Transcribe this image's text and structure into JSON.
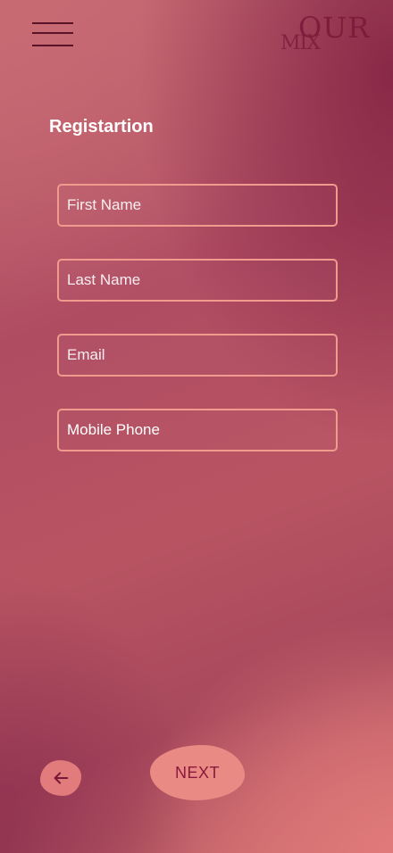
{
  "header": {
    "logo_line1": "OUR",
    "logo_line2": "MIX"
  },
  "form": {
    "title": "Registartion",
    "fields": [
      {
        "placeholder": "First Name"
      },
      {
        "placeholder": "Last Name"
      },
      {
        "placeholder": "Email"
      },
      {
        "value": "Mobile Phone"
      }
    ]
  },
  "footer": {
    "back_icon": "arrow-left-icon",
    "next_label": "NEXT"
  },
  "colors": {
    "accent_border": "#f19a8e",
    "button_fill": "#e98a84",
    "button_text": "#8a1a3c"
  }
}
